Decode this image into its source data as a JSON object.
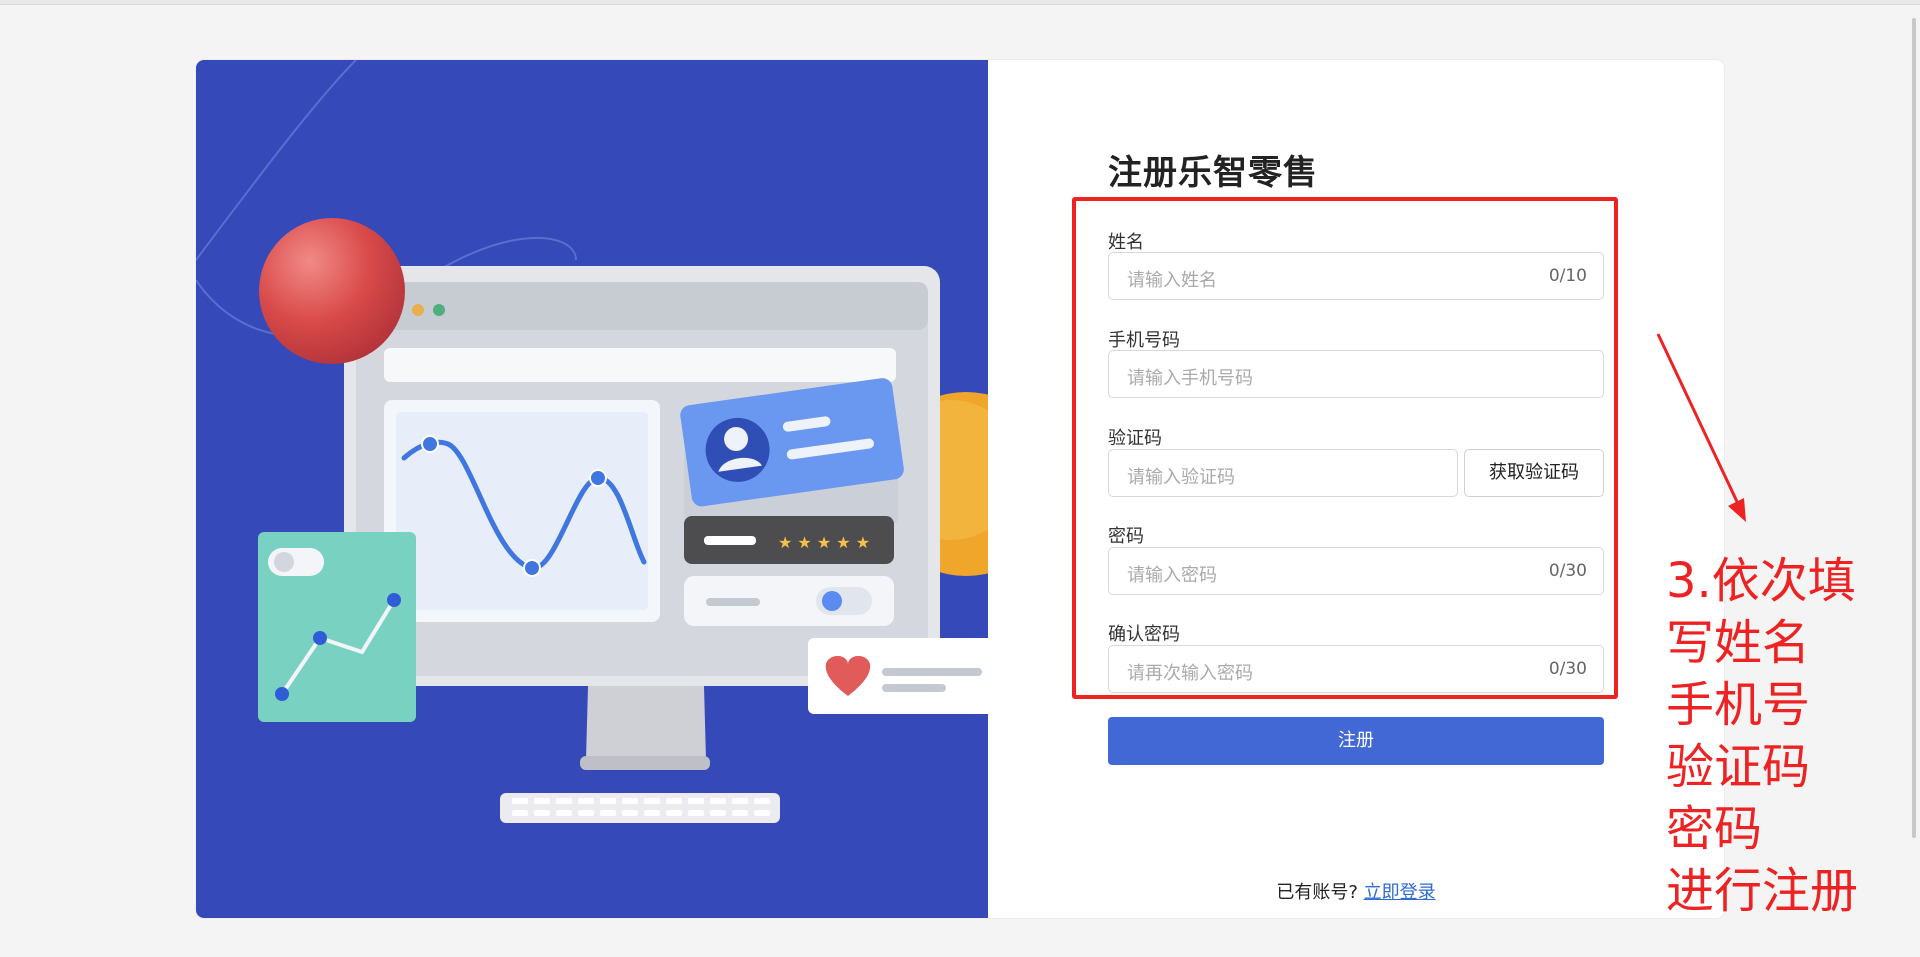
{
  "page": {
    "title": "注册乐智零售"
  },
  "form": {
    "name": {
      "label": "姓名",
      "placeholder": "请输入姓名",
      "counter": "0/10"
    },
    "phone": {
      "label": "手机号码",
      "placeholder": "请输入手机号码"
    },
    "code": {
      "label": "验证码",
      "placeholder": "请输入验证码",
      "button": "获取验证码"
    },
    "password": {
      "label": "密码",
      "placeholder": "请输入密码",
      "counter": "0/30"
    },
    "confirm": {
      "label": "确认密码",
      "placeholder": "请再次输入密码",
      "counter": "0/30"
    },
    "submit": "注册"
  },
  "footer": {
    "prompt": "已有账号?",
    "link": "立即登录"
  },
  "annotation": {
    "color": "#ee2222",
    "lines": [
      "3.依次填",
      "写姓名",
      "手机号",
      "验证码",
      "密码",
      "进行注册"
    ]
  },
  "colors": {
    "hero_background": "#3649b8",
    "primary_button": "#4168d5",
    "link": "#2f6ad0"
  }
}
